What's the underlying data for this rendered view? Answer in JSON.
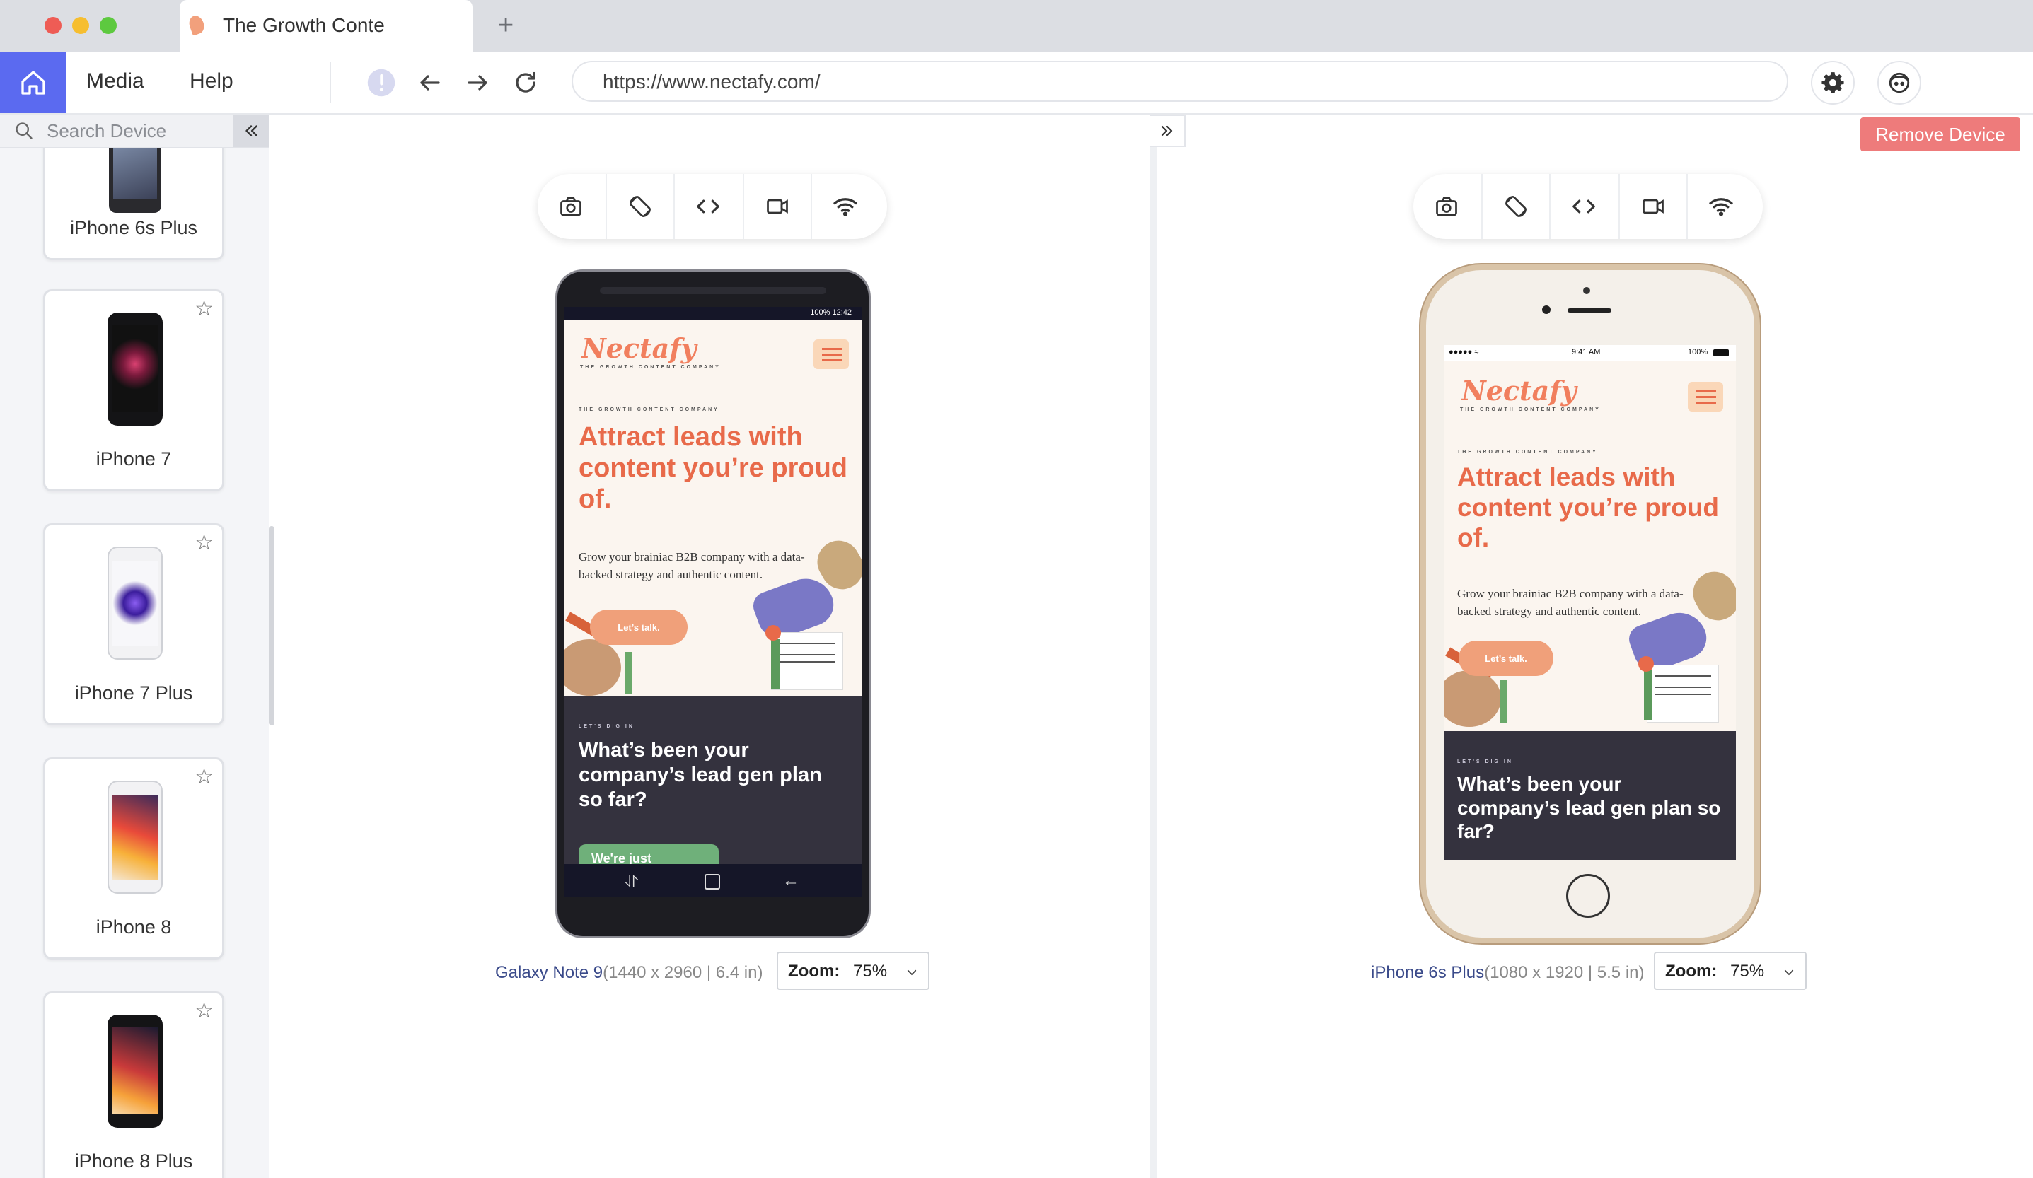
{
  "window": {
    "tab_title": "The Growth Conte",
    "new_tab": "+"
  },
  "toolbar": {
    "menu_media": "Media",
    "menu_help": "Help",
    "url": "https://www.nectafy.com/"
  },
  "sidebar": {
    "search_placeholder": "Search Device",
    "devices": [
      {
        "label": "iPhone 6s Plus"
      },
      {
        "label": "iPhone 7"
      },
      {
        "label": "iPhone 7 Plus"
      },
      {
        "label": "iPhone 8"
      },
      {
        "label": "iPhone 8 Plus"
      }
    ]
  },
  "main": {
    "remove_device": "Remove Device",
    "site": {
      "logo": "Nectafy",
      "logo_tagline": "THE GROWTH CONTENT COMPANY",
      "eyebrow": "THE GROWTH CONTENT COMPANY",
      "headline": "Attract leads with content you’re proud of.",
      "body": "Grow your brainiac B2B company with a data-backed strategy and authentic content.",
      "cta": "Let’s talk.",
      "section_eyebrow": "LET'S DIG IN",
      "section_title": "What’s been your company’s lead gen plan so far?",
      "section_button": "We're just"
    },
    "left_device": {
      "name": "Galaxy Note 9",
      "spec": "(1440 x 2960 | 6.4 in)",
      "zoom_label": "Zoom:",
      "zoom_value": "75%",
      "status_right": "100% 12:42"
    },
    "right_device": {
      "name": "iPhone 6s Plus",
      "spec": "(1080 x 1920 | 5.5 in)",
      "zoom_label": "Zoom:",
      "zoom_value": "75%",
      "status_time": "9:41 AM",
      "status_battery": "100%"
    }
  }
}
